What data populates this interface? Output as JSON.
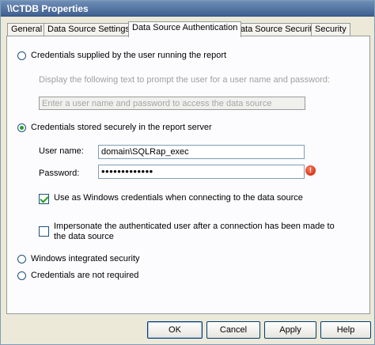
{
  "window": {
    "title": "\\\\CTDB Properties"
  },
  "tabs": [
    {
      "label": "General"
    },
    {
      "label": "Data Source Settings"
    },
    {
      "label": "Data Source Authentication"
    },
    {
      "label": "Data Source Security"
    },
    {
      "label": "Security"
    }
  ],
  "active_tab": "Data Source Authentication",
  "options": {
    "user_supplied": {
      "label": "Credentials supplied by the user running the report",
      "checked": false
    },
    "prompt_text_label": "Display the following text to prompt the user for a user name and password:",
    "prompt_text_value": "Enter a user name and password to access the data source",
    "stored": {
      "label": "Credentials stored securely in the report server",
      "checked": true
    },
    "windows_integrated": {
      "label": "Windows integrated security",
      "checked": false
    },
    "not_required": {
      "label": "Credentials are not required",
      "checked": false
    }
  },
  "stored_credentials": {
    "username_label": "User name:",
    "username_value": "domain\\SQLRap_exec",
    "password_label": "Password:",
    "password_value": "•••••••••••••",
    "use_windows_credentials": {
      "label": "Use as Windows credentials when connecting to the data source",
      "checked": true
    },
    "impersonate": {
      "label": "Impersonate the authenticated user after a connection has been made to the data source",
      "checked": false
    },
    "error_icon": "error-icon",
    "error_glyph": "!"
  },
  "buttons": {
    "ok": "OK",
    "cancel": "Cancel",
    "apply": "Apply",
    "help": "Help"
  },
  "colors": {
    "title_bar": "#4f6f9f",
    "checked_mark": "#21a121",
    "error": "#c81e00"
  }
}
